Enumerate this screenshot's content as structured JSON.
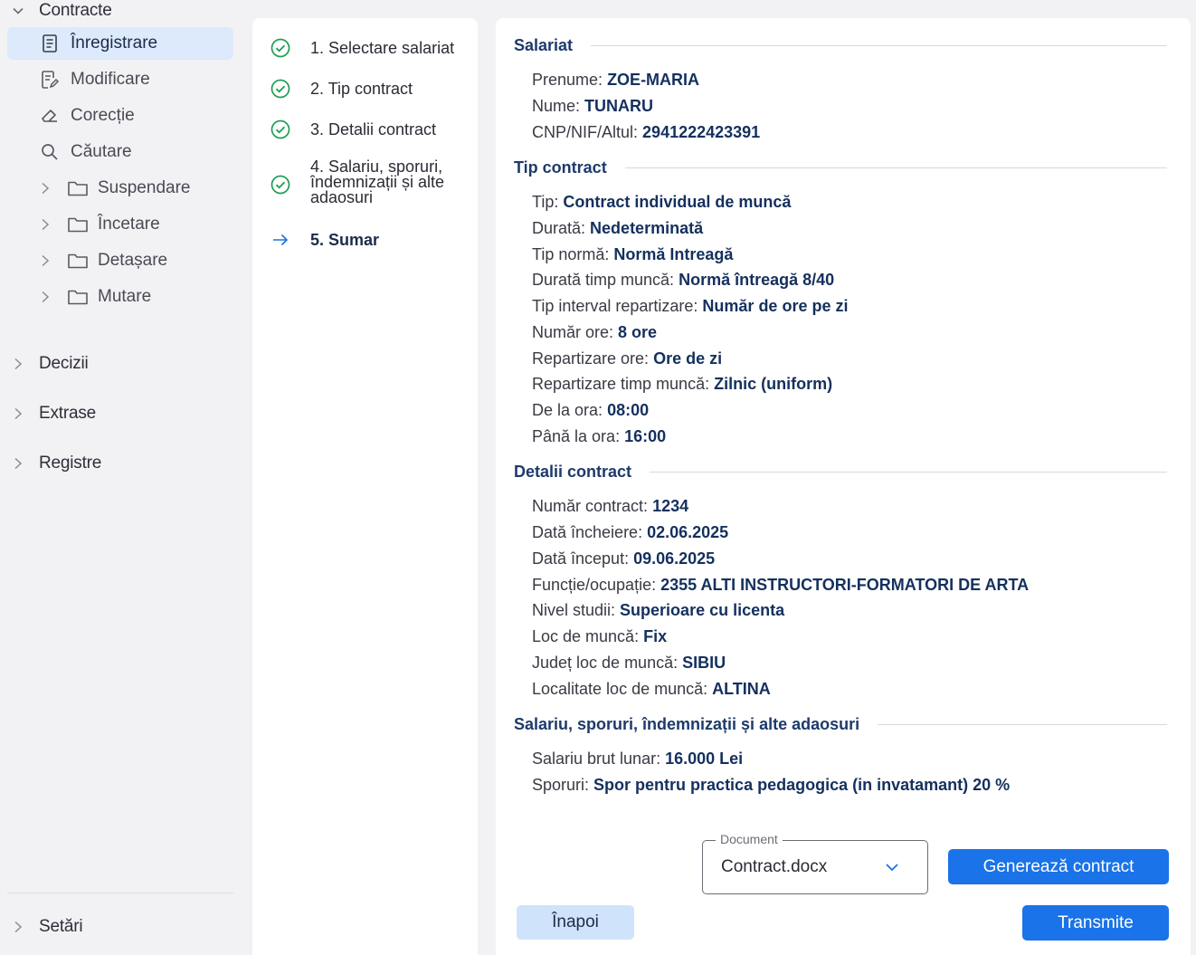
{
  "sidebar": {
    "contracte": "Contracte",
    "items": {
      "inregistrare": "Înregistrare",
      "modificare": "Modificare",
      "corectie": "Corecție",
      "cautare": "Căutare"
    },
    "subgroups": {
      "suspendare": "Suspendare",
      "incetare": "Încetare",
      "detasare": "Detașare",
      "mutare": "Mutare"
    },
    "decizii": "Decizii",
    "extrase": "Extrase",
    "registre": "Registre",
    "setari": "Setări"
  },
  "steps": {
    "s1": "1. Selectare salariat",
    "s2": "2. Tip contract",
    "s3": "3. Detalii contract",
    "s4": "4. Salariu, sporuri, îndemnizații și alte adaosuri",
    "s5": "5. Sumar"
  },
  "summary": {
    "salariat": {
      "title": "Salariat",
      "prenume_label": "Prenume:",
      "prenume": "ZOE-MARIA",
      "nume_label": "Nume:",
      "nume": "TUNARU",
      "cnp_label": "CNP/NIF/Altul:",
      "cnp": "2941222423391"
    },
    "tip": {
      "title": "Tip contract",
      "tip_label": "Tip:",
      "tip": "Contract individual de muncă",
      "durata_label": "Durată:",
      "durata": "Nedeterminată",
      "norma_label": "Tip normă:",
      "norma": "Normă Intreagă",
      "timp_label": "Durată timp muncă:",
      "timp": "Normă întreagă 8/40",
      "interval_label": "Tip interval repartizare:",
      "interval": "Număr de ore pe zi",
      "ore_label": "Număr ore:",
      "ore": "8 ore",
      "rep_ore_label": "Repartizare ore:",
      "rep_ore": "Ore de zi",
      "rep_timp_label": "Repartizare timp muncă:",
      "rep_timp": "Zilnic (uniform)",
      "de_la_label": "De la ora:",
      "de_la": "08:00",
      "pana_label": "Până la ora:",
      "pana": "16:00"
    },
    "detalii": {
      "title": "Detalii contract",
      "nr_label": "Număr contract:",
      "nr": "1234",
      "incheiere_label": "Dată încheiere:",
      "incheiere": "02.06.2025",
      "inceput_label": "Dată început:",
      "inceput": "09.06.2025",
      "functie_label": "Funcție/ocupație:",
      "functie": "2355 ALTI INSTRUCTORI-FORMATORI DE ARTA",
      "studii_label": "Nivel studii:",
      "studii": "Superioare cu licenta",
      "loc_label": "Loc de muncă:",
      "loc": "Fix",
      "judet_label": "Județ loc de muncă:",
      "judet": "SIBIU",
      "localitate_label": "Localitate loc de muncă:",
      "localitate": "ALTINA"
    },
    "salariu": {
      "title": "Salariu, sporuri, îndemnizații și alte adaosuri",
      "brut_label": "Salariu brut lunar:",
      "brut": "16.000 Lei",
      "sporuri_label": "Sporuri:",
      "sporuri": "Spor pentru practica pedagogica (in invatamant) 20 %"
    }
  },
  "document": {
    "legend": "Document",
    "value": "Contract.docx"
  },
  "buttons": {
    "genereaza": "Generează contract",
    "inapoi": "Înapoi",
    "transmite": "Transmite"
  },
  "colors": {
    "accent": "#1a73e8",
    "success": "#1e9e55",
    "active_bg": "#dceafb",
    "value_text": "#14305e"
  }
}
